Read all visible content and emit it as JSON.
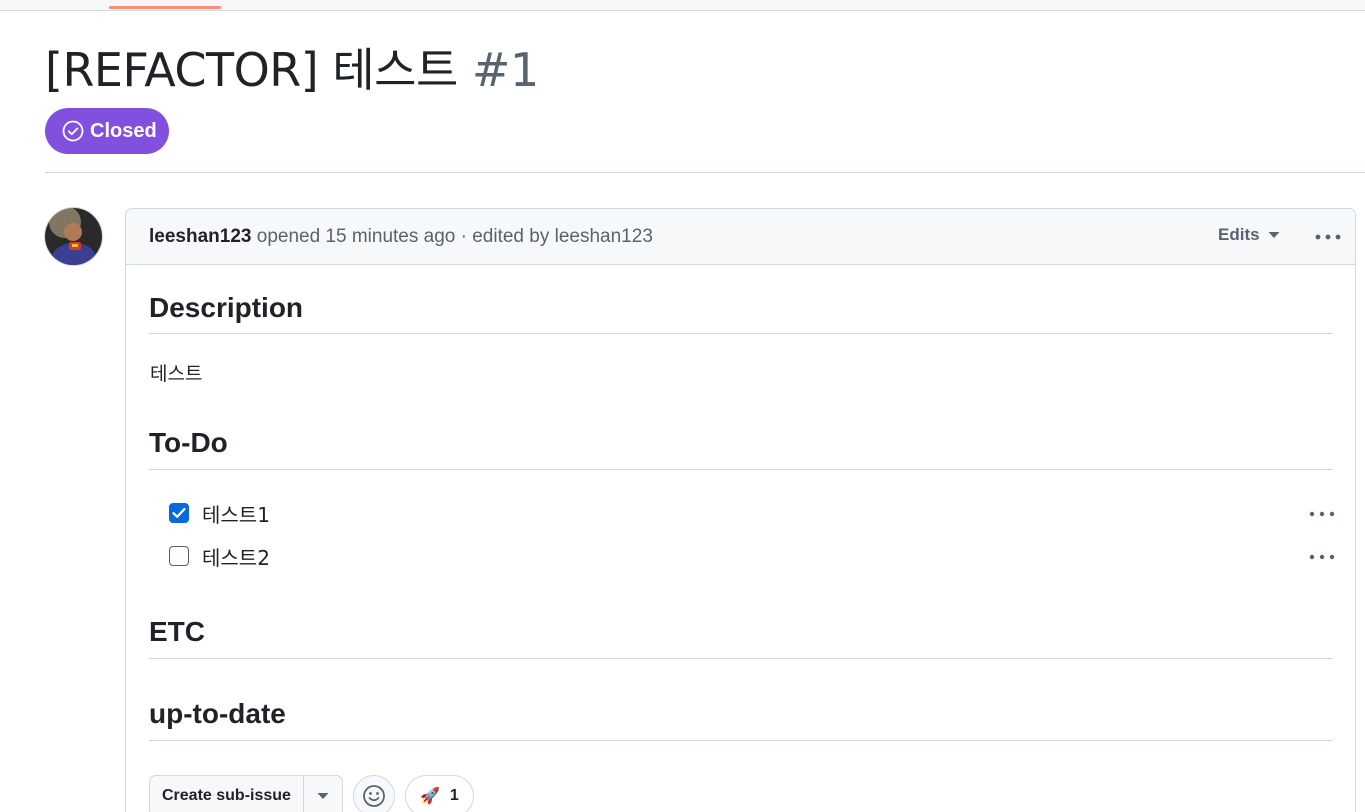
{
  "issue": {
    "title": "[REFACTOR] 테스트",
    "number": "#1",
    "state": "Closed",
    "state_color": "#8250df"
  },
  "comment": {
    "author": "leeshan123",
    "meta_suffix": "opened 15 minutes ago · edited by leeshan123",
    "edits_label": "Edits",
    "avatar": "user-avatar"
  },
  "body": {
    "description_heading": "Description",
    "description_text": "테스트",
    "todo_heading": "To-Do",
    "tasks": [
      {
        "label": "테스트1",
        "checked": true
      },
      {
        "label": "테스트2",
        "checked": false
      }
    ],
    "etc_heading": "ETC",
    "uptodate_heading": "up-to-date"
  },
  "actions": {
    "create_sub_issue": "Create sub-issue",
    "reaction_emoji": "🚀",
    "reaction_count": "1"
  },
  "colors": {
    "accent_blue": "#0969da",
    "closed_purple": "#8250df",
    "tab_underline": "#fd8c73"
  }
}
